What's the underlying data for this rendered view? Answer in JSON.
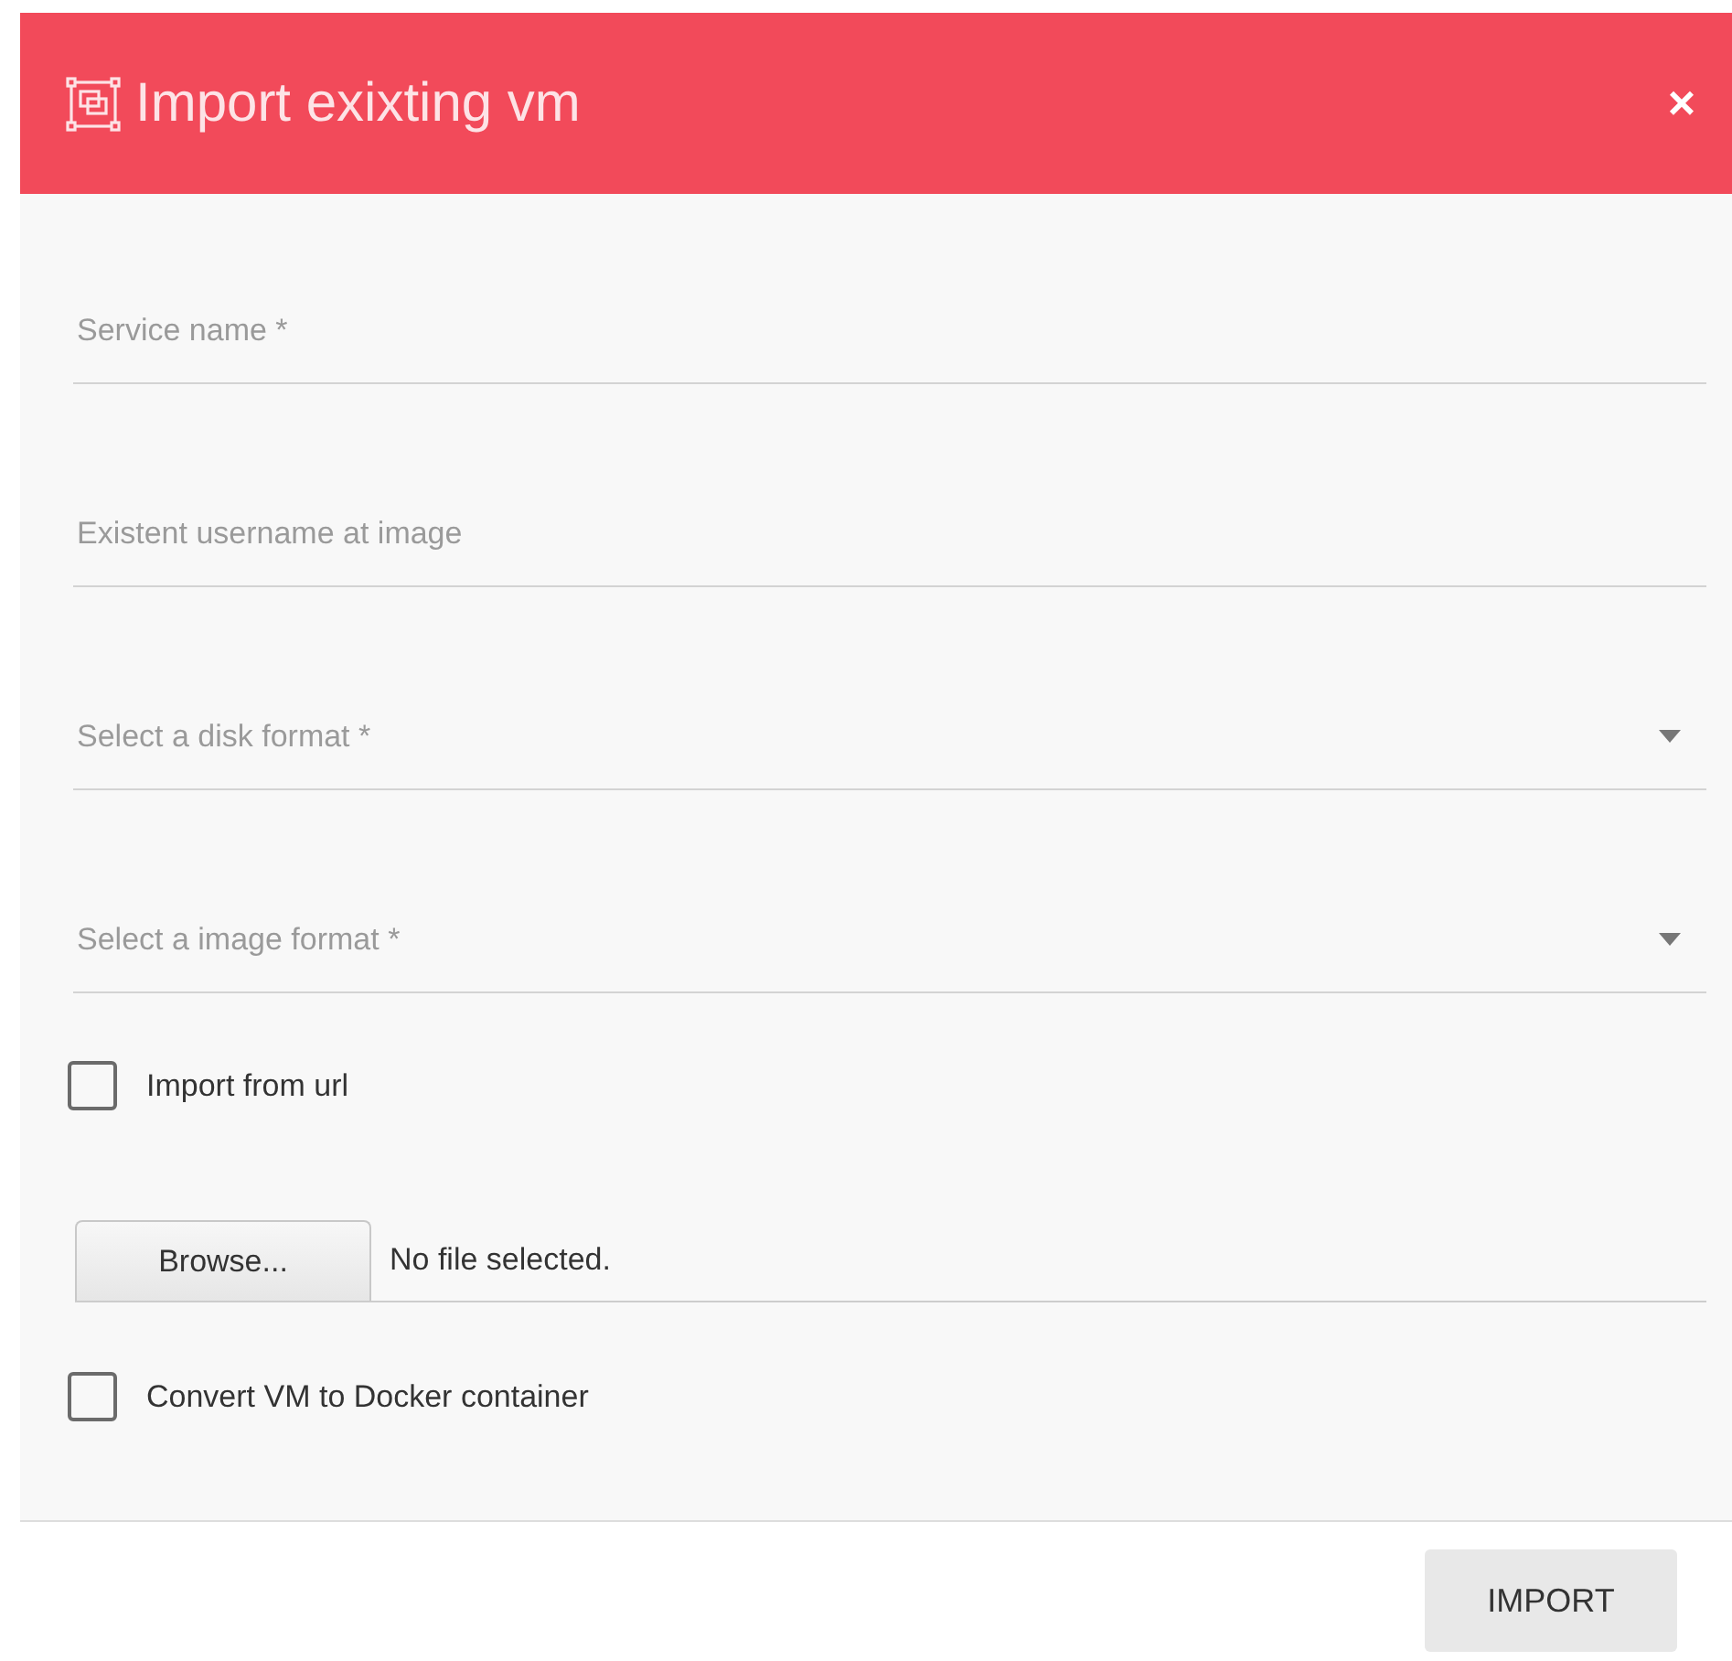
{
  "dialog": {
    "title": "Import exixting vm",
    "close": "×"
  },
  "fields": [
    {
      "kind": "text",
      "placeholder": "Service name *"
    },
    {
      "kind": "text",
      "placeholder": "Existent username at image"
    },
    {
      "kind": "select",
      "placeholder": "Select a disk format *"
    },
    {
      "kind": "select",
      "placeholder": "Select a image format *"
    }
  ],
  "import_from_url": {
    "label": "Import from url",
    "checked": false
  },
  "file_input": {
    "button": "Browse...",
    "status": "No file selected."
  },
  "convert_to_docker": {
    "label": "Convert VM to Docker container",
    "checked": false
  },
  "footer": {
    "button": "IMPORT"
  }
}
